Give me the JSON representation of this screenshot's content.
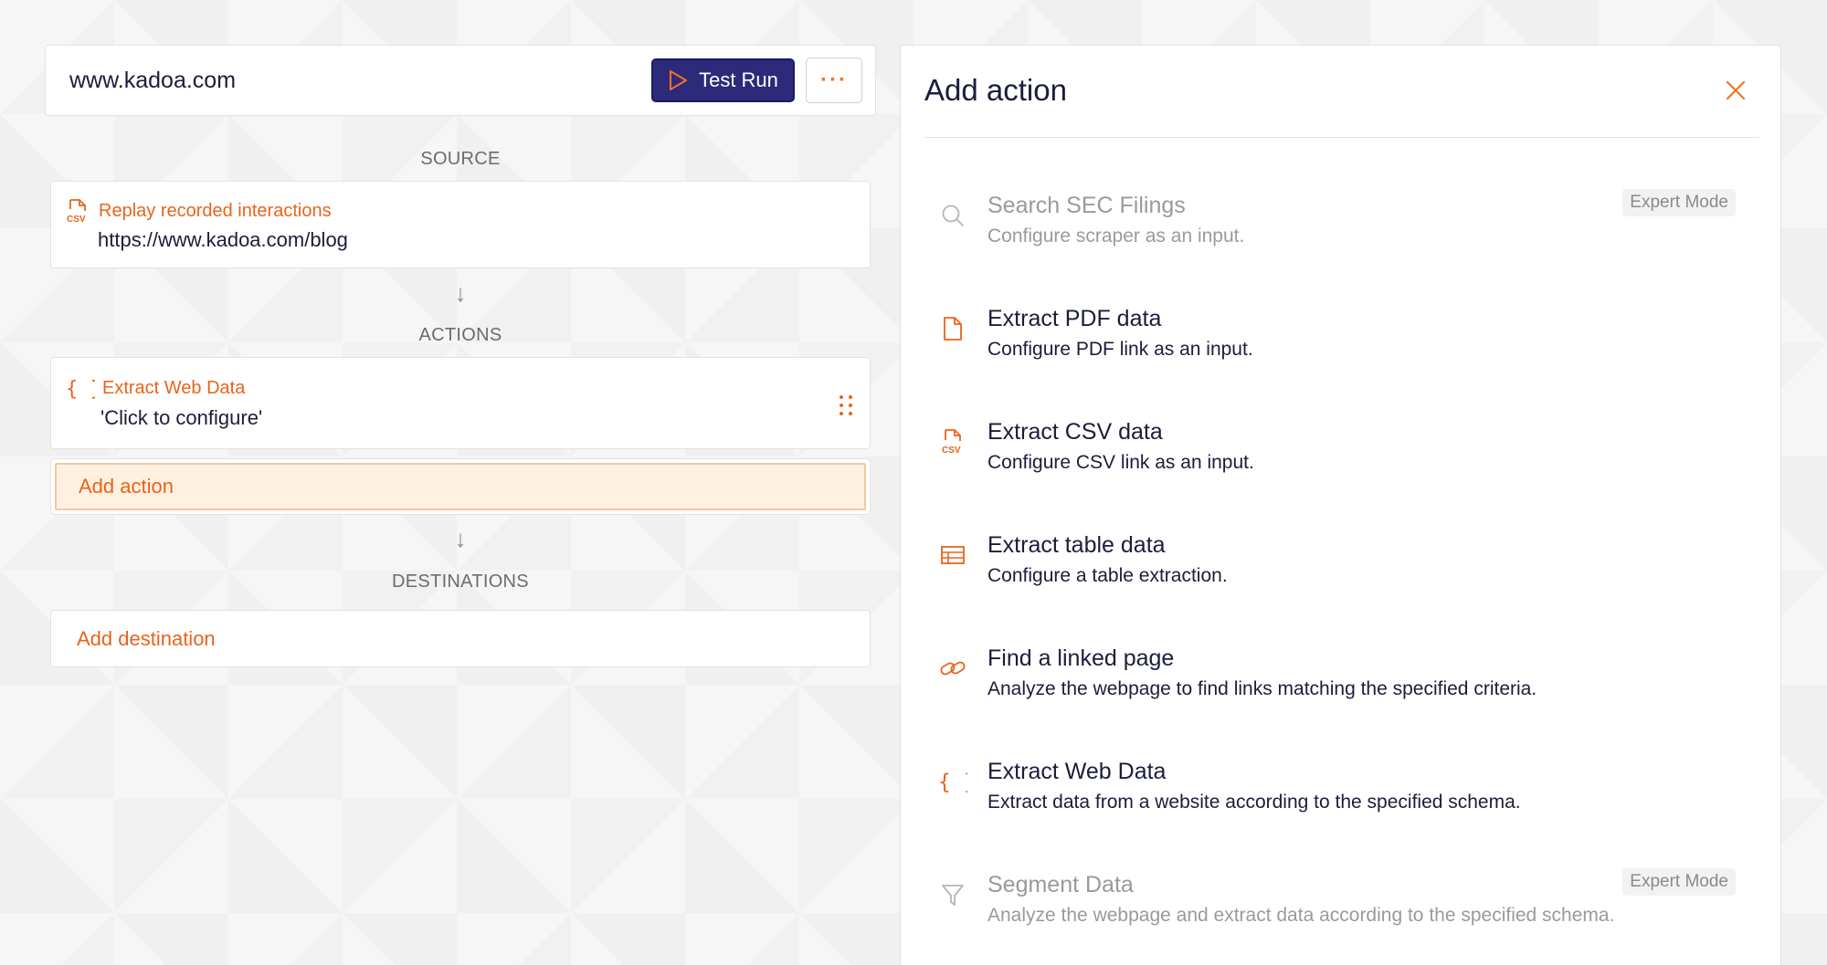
{
  "header": {
    "site": "www.kadoa.com",
    "test_run_label": "Test Run",
    "more_label": "···"
  },
  "workflow": {
    "source_label": "SOURCE",
    "source": {
      "icon": "csv-file-icon",
      "title": "Replay recorded interactions",
      "url": "https://www.kadoa.com/blog"
    },
    "actions_label": "ACTIONS",
    "action": {
      "icon": "braces-icon",
      "title": "Extract Web Data",
      "subtitle": "'Click to configure'"
    },
    "add_action_label": "Add action",
    "destinations_label": "DESTINATIONS",
    "add_destination_label": "Add destination"
  },
  "panel": {
    "title": "Add action",
    "options": [
      {
        "icon": "search-icon",
        "name": "Search SEC Filings",
        "desc": "Configure scraper as an input.",
        "badge": "Expert Mode",
        "disabled": true
      },
      {
        "icon": "pdf-file-icon",
        "name": "Extract PDF data",
        "desc": "Configure PDF link as an input.",
        "badge": "",
        "disabled": false
      },
      {
        "icon": "csv-file-icon",
        "name": "Extract CSV data",
        "desc": "Configure CSV link as an input.",
        "badge": "",
        "disabled": false
      },
      {
        "icon": "table-icon",
        "name": "Extract table data",
        "desc": "Configure a table extraction.",
        "badge": "",
        "disabled": false
      },
      {
        "icon": "link-icon",
        "name": "Find a linked page",
        "desc": "Analyze the webpage to find links matching the specified criteria.",
        "badge": "",
        "disabled": false
      },
      {
        "icon": "braces-icon",
        "name": "Extract Web Data",
        "desc": "Extract data from a website according to the specified schema.",
        "badge": "",
        "disabled": false
      },
      {
        "icon": "filter-icon",
        "name": "Segment Data",
        "desc": "Analyze the webpage and extract data according to the specified schema.",
        "badge": "Expert Mode",
        "disabled": true
      }
    ]
  },
  "colors": {
    "accent": "#e8641b",
    "primary": "#2d2a7a",
    "text": "#1b1d3d",
    "muted": "#9a9a9a"
  }
}
